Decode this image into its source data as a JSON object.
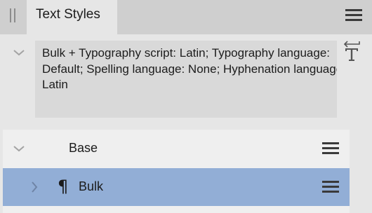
{
  "panel": {
    "tab_label": "Text Styles",
    "icons": {
      "grip": "panel-grip-icon",
      "panel_menu": "hamburger-menu-icon",
      "apply_style": "text-style-apply-icon"
    }
  },
  "style_description": {
    "text": "Bulk + Typography script: Latin; Typography language: Default; Spelling language: None; Hyphenation language: Latin"
  },
  "styles_list": {
    "items": [
      {
        "label": "Base",
        "expanded": true,
        "selected": false
      },
      {
        "label": "Bulk",
        "expanded": false,
        "selected": true,
        "icon": "paragraph-icon",
        "icon_glyph": "¶"
      }
    ]
  },
  "colors": {
    "titlebar": "#cfcfcf",
    "panel_background": "#e6e6e6",
    "description_background": "#d9d9d9",
    "selected_row": "#92aed6",
    "row_background": "#efefef"
  }
}
